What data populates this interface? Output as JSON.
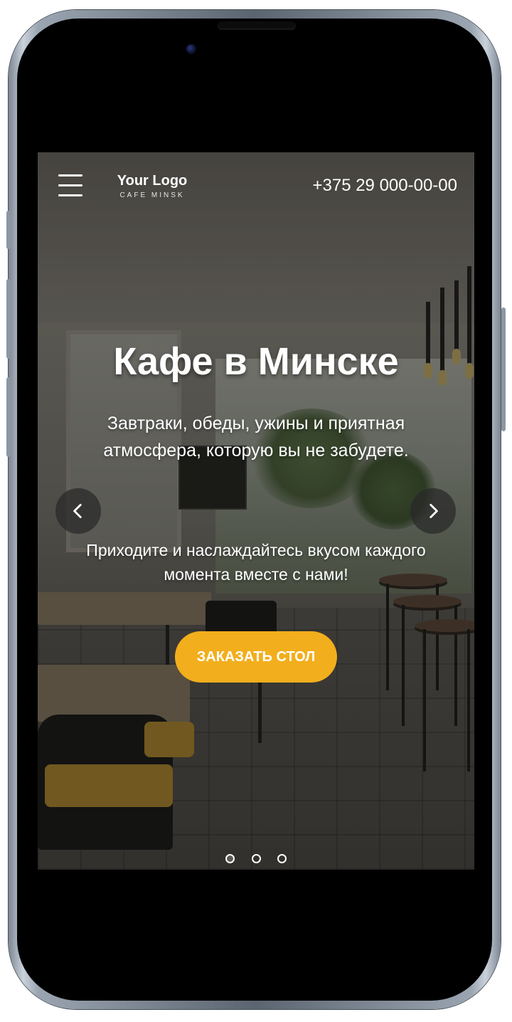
{
  "header": {
    "menu_icon": "hamburger-menu-icon",
    "logo_title": "Your Logo",
    "logo_subtitle": "CAFE MINSK",
    "phone": "+375 29 000-00-00"
  },
  "hero": {
    "title": "Кафе в Минске",
    "subtitle": "Завтраки, обеды, ужины и приятная атмосфера, которую вы не забудете.",
    "tagline": "Приходите и наслаждайтесь вкусом каждого момента вместе с нами!",
    "cta_label": "ЗАКАЗАТЬ СТОЛ"
  },
  "carousel": {
    "prev_icon": "chevron-left-icon",
    "next_icon": "chevron-right-icon",
    "slides": 3,
    "active_slide": 1
  },
  "colors": {
    "accent": "#f2ae1c",
    "text": "#ffffff",
    "arrow_bg": "#282828"
  }
}
